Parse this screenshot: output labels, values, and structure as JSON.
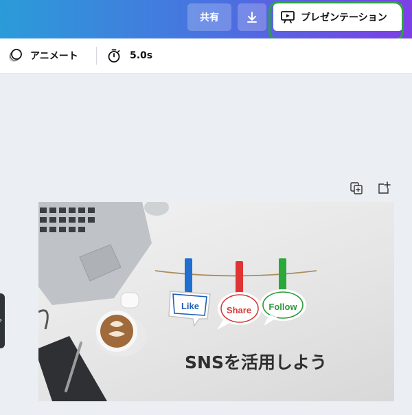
{
  "header": {
    "share_label": "共有",
    "download_icon": "download-icon",
    "present_label": "プレゼンテーション",
    "present_icon": "presentation-icon",
    "gradient": [
      "#2b9bd9",
      "#7d3fe6"
    ],
    "highlight_color": "#2aa540"
  },
  "toolbar": {
    "animate_label": "アニメート",
    "animate_icon": "animate-icon",
    "duration_value": "5.0s",
    "duration_icon": "timer-icon"
  },
  "page_actions": {
    "duplicate_icon": "duplicate-page-icon",
    "add_icon": "add-page-icon"
  },
  "slide": {
    "title": "SNSを活用しよう",
    "tags": [
      "Like",
      "Share",
      "Follow"
    ],
    "tag_colors": [
      "#1e5fb8",
      "#d63a3a",
      "#2a9a3a"
    ]
  }
}
